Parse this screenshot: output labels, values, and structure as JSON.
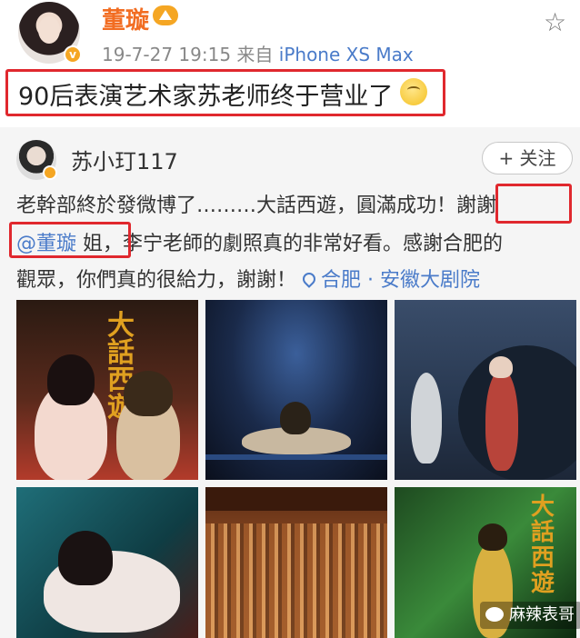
{
  "post": {
    "author": "董璇",
    "meta_time": "19-7-27 19:15",
    "meta_from": "来自",
    "meta_device": "iPhone XS Max",
    "text": "90后表演艺术家苏老师终于营业了"
  },
  "repost": {
    "author": "苏小玎117",
    "follow_label": "+ 关注",
    "line1": "老幹部終於發微博了………大話西遊，圓滿成功！謝謝",
    "mention": "@董璇",
    "line2_rest": " 姐，李宁老師的劇照真的非常好看。感謝合肥的",
    "line3": "觀眾，你們真的很給力，謝謝！",
    "location": "合肥 · 安徽大剧院"
  },
  "photos": {
    "poster_title": "大話西遊"
  },
  "watermark": "麻辣表哥",
  "colors": {
    "author_orange": "#f26d22",
    "link_blue": "#4a7bc9",
    "highlight_red": "#e0282e",
    "verified_gold": "#f5a623"
  },
  "icons": [
    "crown-icon",
    "star-icon",
    "emoji-icon",
    "location-pin-icon",
    "wechat-icon",
    "verified-badge-icon"
  ]
}
